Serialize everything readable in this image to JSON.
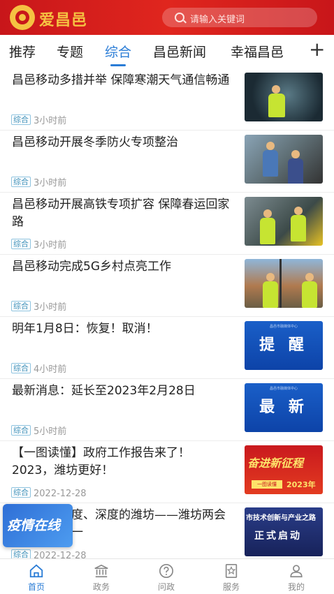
{
  "header": {
    "app_title": "爱昌邑",
    "search_placeholder": "请输入关键词",
    "brand_color": "#d11c1e"
  },
  "tabs": [
    {
      "label": "推荐"
    },
    {
      "label": "专题"
    },
    {
      "label": "综合",
      "active": true
    },
    {
      "label": "昌邑新闻"
    },
    {
      "label": "幸福昌邑"
    }
  ],
  "add_tab_label": "+",
  "news": [
    {
      "title": "昌邑移动多措并举  保障寒潮天气通信畅通",
      "tag": "综合",
      "time": "3小时前"
    },
    {
      "title": "昌邑移动开展冬季防火专项整治",
      "tag": "综合",
      "time": "3小时前"
    },
    {
      "title": "昌邑移动开展高铁专项扩容  保障春运回家路",
      "tag": "综合",
      "time": "3小时前"
    },
    {
      "title": "昌邑移动完成5G乡村点亮工作",
      "tag": "综合",
      "time": "3小时前"
    },
    {
      "title": "明年1月8日：恢复！取消！",
      "tag": "综合",
      "time": "4小时前",
      "thumb_text": "提 醒"
    },
    {
      "title": "最新消息：延长至2023年2月28日",
      "tag": "综合",
      "time": "5小时前",
      "thumb_text": "最 新"
    },
    {
      "title": "【一图读懂】政府工作报告来了！2023，潍坊更好！",
      "tag": "综合",
      "time": "2022-12-28",
      "thumb_text": "奋进新征程",
      "thumb_sub": "2023年",
      "thumb_box": "一图读懂"
    },
    {
      "title": "有高度、温度、深度的潍坊——潍坊两会系列述评之一",
      "tag": "综合",
      "time": "2022-12-28",
      "thumb_text": "市技术创新与产业之路",
      "thumb_sub": "正式启动"
    }
  ],
  "thumb_caption": "昌邑市融媒体中心",
  "floating_banner": "疫情在线",
  "bottom_nav": [
    {
      "label": "首页",
      "icon": "home-icon",
      "active": true
    },
    {
      "label": "政务",
      "icon": "government-building-icon"
    },
    {
      "label": "问政",
      "icon": "question-icon"
    },
    {
      "label": "服务",
      "icon": "star-service-icon"
    },
    {
      "label": "我的",
      "icon": "user-icon"
    }
  ]
}
